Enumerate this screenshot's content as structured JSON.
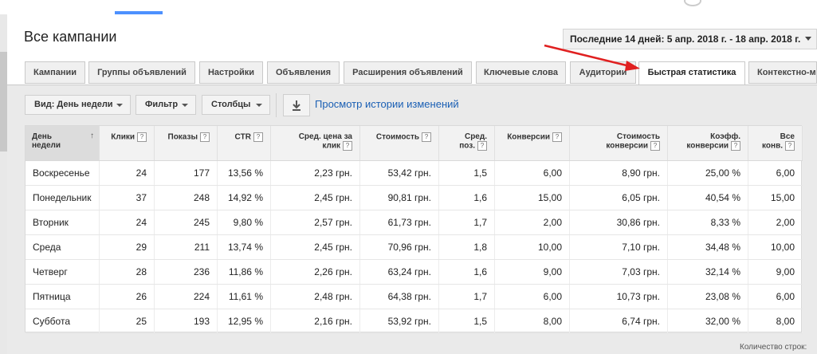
{
  "page_title": "Все кампании",
  "date_range": "Последние 14 дней: 5 апр. 2018 г. - 18 апр. 2018 г.",
  "tabs": [
    {
      "label": "Кампании"
    },
    {
      "label": "Группы объявлений"
    },
    {
      "label": "Настройки"
    },
    {
      "label": "Объявления"
    },
    {
      "label": "Расширения объявлений"
    },
    {
      "label": "Ключевые слова"
    },
    {
      "label": "Аудитории"
    },
    {
      "label": "Быстрая статистика",
      "active": true
    },
    {
      "label": "Контекстно-медийная"
    }
  ],
  "toolbar": {
    "view_label": "Вид: День недели",
    "filter_label": "Фильтр",
    "columns_label": "Столбцы",
    "history_link": "Просмотр истории изменений"
  },
  "table": {
    "columns": [
      {
        "label": [
          "День",
          "недели"
        ],
        "help": false
      },
      {
        "label": [
          "Клики"
        ],
        "help": true
      },
      {
        "label": [
          "Показы"
        ],
        "help": true
      },
      {
        "label": [
          "CTR"
        ],
        "help": true
      },
      {
        "label": [
          "Сред. цена за",
          "клик"
        ],
        "help": true
      },
      {
        "label": [
          "Стоимость"
        ],
        "help": true
      },
      {
        "label": [
          "Сред.",
          "поз."
        ],
        "help": true
      },
      {
        "label": [
          "Конверсии"
        ],
        "help": true
      },
      {
        "label": [
          "Стоимость",
          "конверсии"
        ],
        "help": true
      },
      {
        "label": [
          "Коэфф.",
          "конверсии"
        ],
        "help": true
      },
      {
        "label": [
          "Все",
          "конв."
        ],
        "help": true
      }
    ],
    "rows": [
      [
        "Воскресенье",
        "24",
        "177",
        "13,56 %",
        "2,23 грн.",
        "53,42 грн.",
        "1,5",
        "6,00",
        "8,90 грн.",
        "25,00 %",
        "6,00"
      ],
      [
        "Понедельник",
        "37",
        "248",
        "14,92 %",
        "2,45 грн.",
        "90,81 грн.",
        "1,6",
        "15,00",
        "6,05 грн.",
        "40,54 %",
        "15,00"
      ],
      [
        "Вторник",
        "24",
        "245",
        "9,80 %",
        "2,57 грн.",
        "61,73 грн.",
        "1,7",
        "2,00",
        "30,86 грн.",
        "8,33 %",
        "2,00"
      ],
      [
        "Среда",
        "29",
        "211",
        "13,74 %",
        "2,45 грн.",
        "70,96 грн.",
        "1,8",
        "10,00",
        "7,10 грн.",
        "34,48 %",
        "10,00"
      ],
      [
        "Четверг",
        "28",
        "236",
        "11,86 %",
        "2,26 грн.",
        "63,24 грн.",
        "1,6",
        "9,00",
        "7,03 грн.",
        "32,14 %",
        "9,00"
      ],
      [
        "Пятница",
        "26",
        "224",
        "11,61 %",
        "2,48 грн.",
        "64,38 грн.",
        "1,7",
        "6,00",
        "10,73 грн.",
        "23,08 %",
        "6,00"
      ],
      [
        "Суббота",
        "25",
        "193",
        "12,95 %",
        "2,16 грн.",
        "53,92 грн.",
        "1,5",
        "8,00",
        "6,74 грн.",
        "32,00 %",
        "8,00"
      ]
    ]
  },
  "footer": {
    "rows_label": "Количество строк:"
  },
  "colors": {
    "accent": "#4d90fe",
    "link": "#1a5fb4",
    "annotation": "#e02020"
  },
  "icons": {
    "download": "download-icon",
    "help": "help-icon",
    "sort": "sort-arrow-icon"
  }
}
